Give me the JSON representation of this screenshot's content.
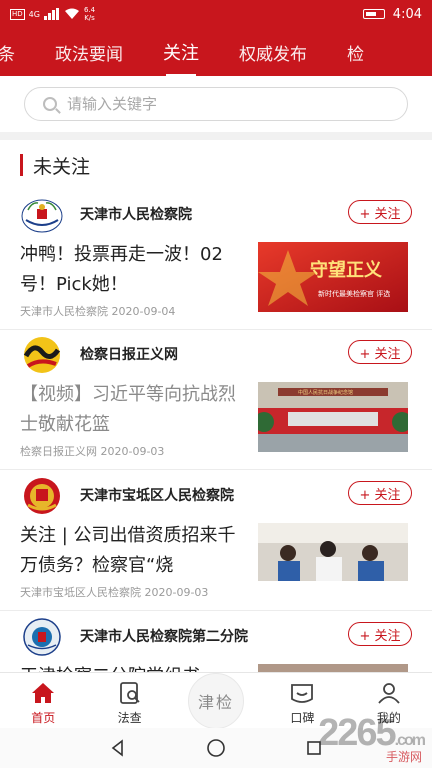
{
  "status_bar": {
    "network": "4G",
    "speed": "6.4",
    "speed_unit": "K/s",
    "time": "4:04"
  },
  "tabs": [
    {
      "label": "条",
      "active": false
    },
    {
      "label": "政法要闻",
      "active": false
    },
    {
      "label": "关注",
      "active": true
    },
    {
      "label": "权威发布",
      "active": false
    },
    {
      "label": "检",
      "active": false
    }
  ],
  "search": {
    "placeholder": "请输入关键字"
  },
  "section": {
    "title": "未关注"
  },
  "cards": [
    {
      "org": "天津市人民检察院",
      "follow_label": "+ 关注",
      "headline": "冲鸭！投票再走一波！02号！Pick她！",
      "muted": false,
      "source": "天津市人民检察院",
      "date": "2020-09-04",
      "thumb_text": "守望正义",
      "thumb_sub": "新时代最美检察官 评选"
    },
    {
      "org": "检察日报正义网",
      "follow_label": "+ 关注",
      "headline": "【视频】习近平等向抗战烈士敬献花篮",
      "muted": true,
      "source": "检察日报正义网",
      "date": "2020-09-03",
      "thumb_text": "中国人民抗日战争纪念馆",
      "thumb_sub": ""
    },
    {
      "org": "天津市宝坻区人民检察院",
      "follow_label": "+ 关注",
      "headline": "关注 | 公司出借资质招来千万债务？检察官“烧",
      "muted": false,
      "source": "天津市宝坻区人民检察院",
      "date": "2020-09-03",
      "thumb_text": "",
      "thumb_sub": ""
    },
    {
      "org": "天津市人民检察院第二分院",
      "follow_label": "+ 关注",
      "headline": "天津检察二分院党组书",
      "muted": false,
      "source": "",
      "date": "",
      "thumb_text": "",
      "thumb_sub": ""
    }
  ],
  "bottom_nav": [
    {
      "label": "首页",
      "icon": "home-icon",
      "active": true
    },
    {
      "label": "法查",
      "icon": "law-search-icon",
      "active": false
    },
    {
      "label": "津检",
      "icon": "center-logo",
      "active": false
    },
    {
      "label": "口碑",
      "icon": "reputation-icon",
      "active": false
    },
    {
      "label": "我的",
      "icon": "profile-icon",
      "active": false
    }
  ],
  "watermark": {
    "text": "2265",
    "domain": ".com",
    "sub": "手游网"
  },
  "colors": {
    "brand_red": "#c8161d",
    "muted_text": "#8a8a8a"
  }
}
